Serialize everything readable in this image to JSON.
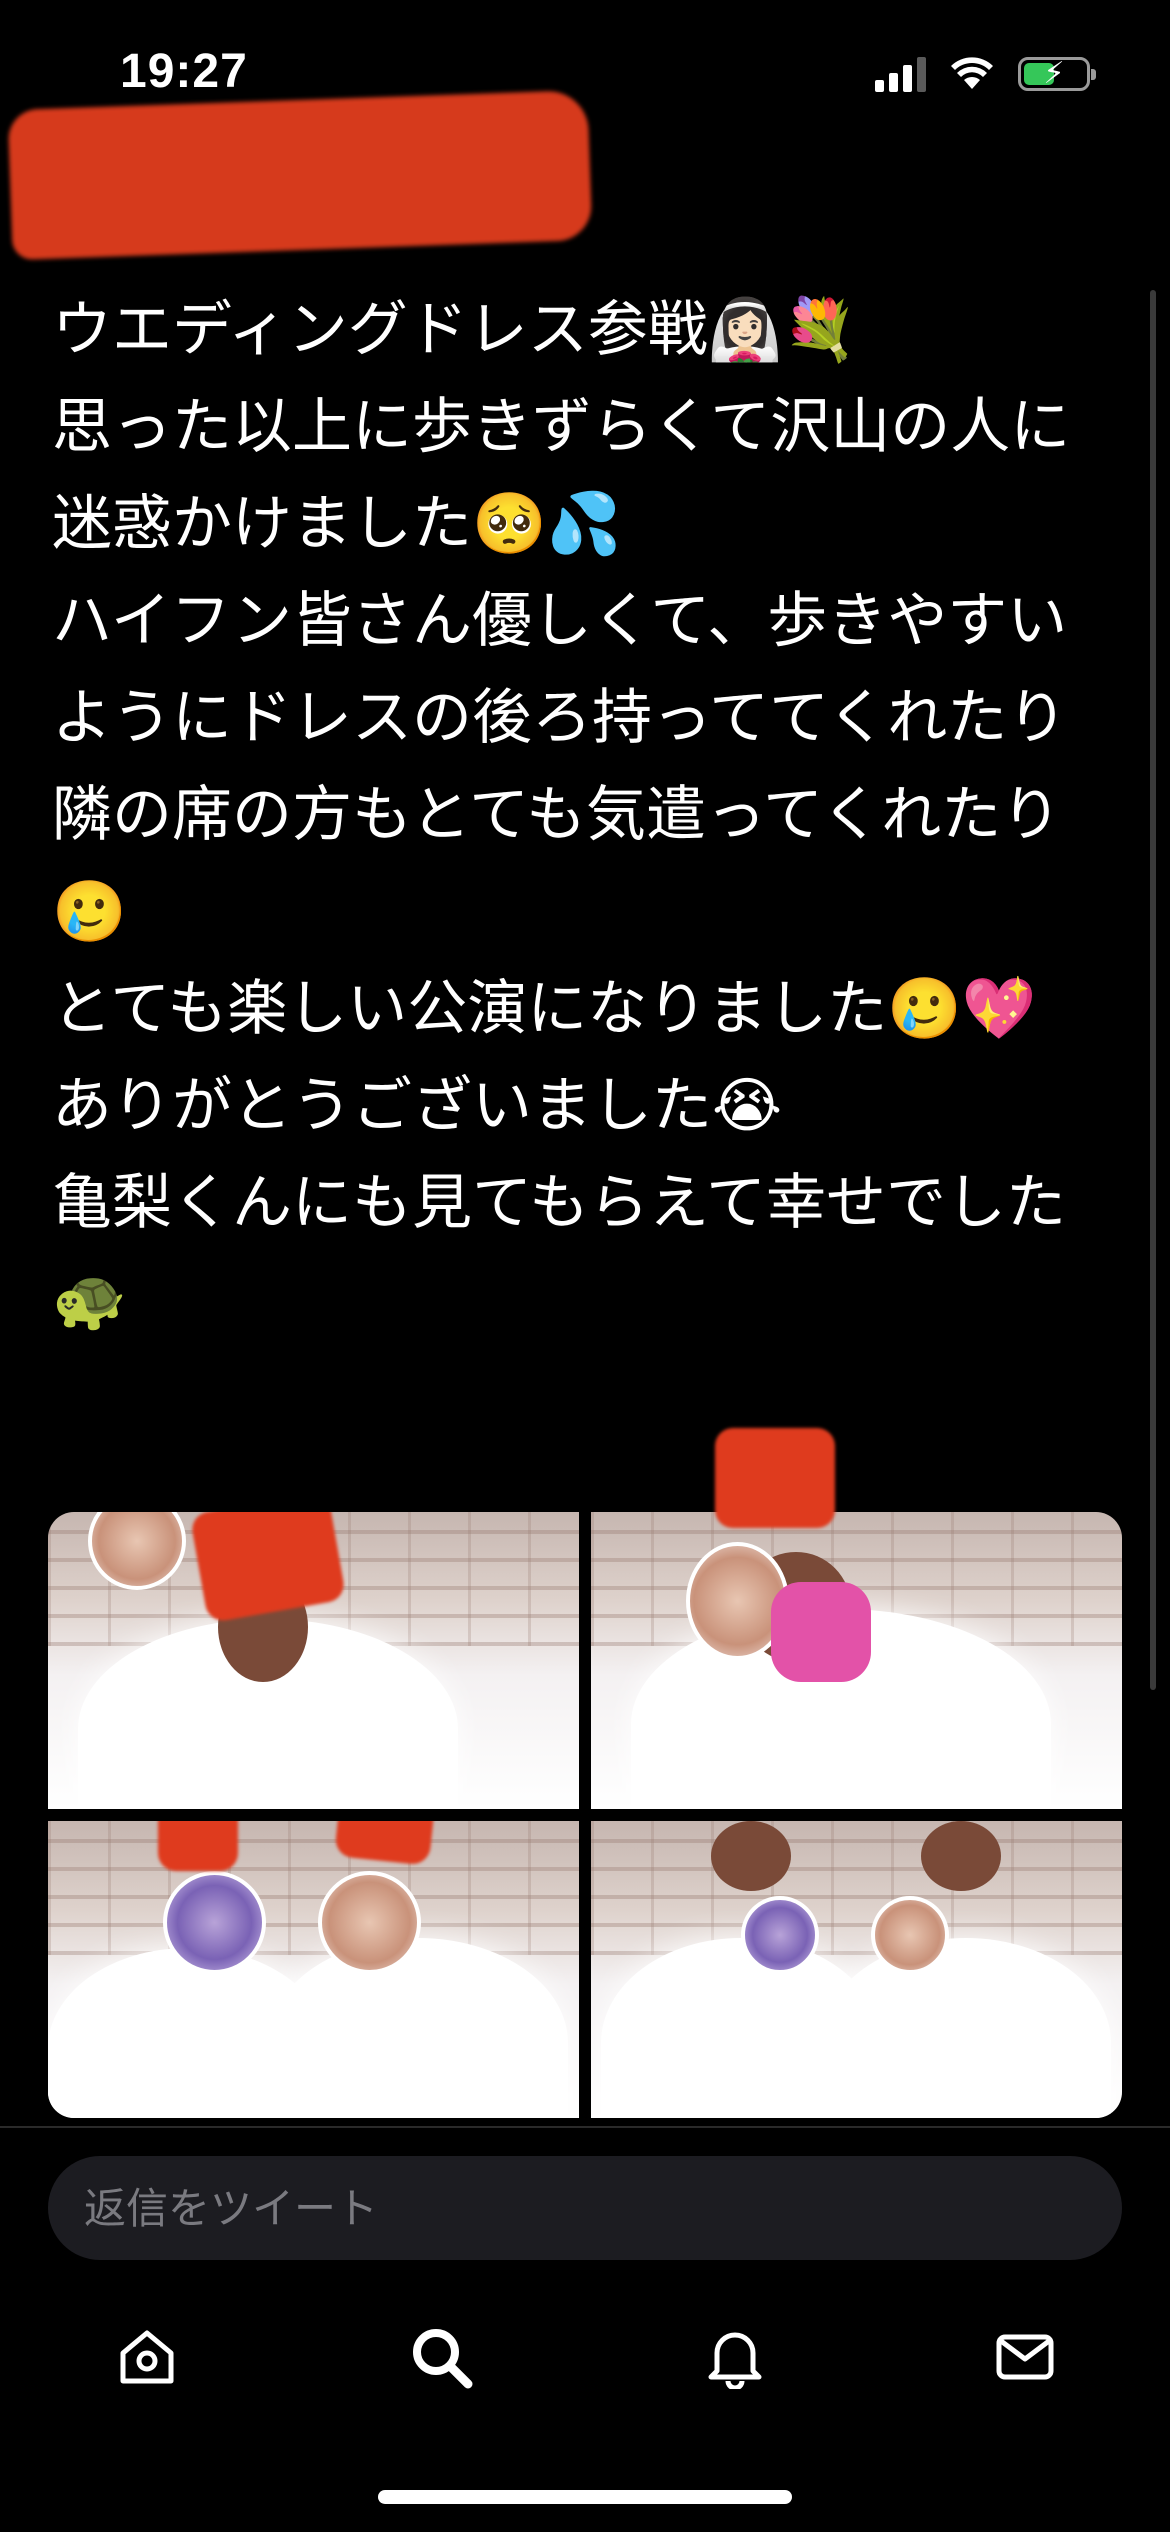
{
  "status_bar": {
    "time": "19:27"
  },
  "tweet": {
    "text": "ウエディングドレス参戦👰🏻‍♀️💐\n思った以上に歩きずらくて沢山の人に迷惑かけました🥺💦\nハイフン皆さん優しくて、歩きやすいようにドレスの後ろ持っててくれたり\n隣の席の方もとても気遣ってくれたり🥲\nとても楽しい公演になりました🥲💖\nありがとうございました😭\n亀梨くんにも見てもらえて幸せでした🐢",
    "media_count": 4
  },
  "reply": {
    "placeholder": "返信をツイート"
  },
  "tab_bar": {
    "items": [
      "home-icon",
      "search-icon",
      "notifications-icon",
      "messages-icon"
    ]
  },
  "colors": {
    "background": "#000000",
    "text": "#ffffff",
    "reply_field": "#1c1c21",
    "placeholder": "#7a7a80",
    "redaction": "#d63a1c",
    "battery": "#35c759"
  }
}
